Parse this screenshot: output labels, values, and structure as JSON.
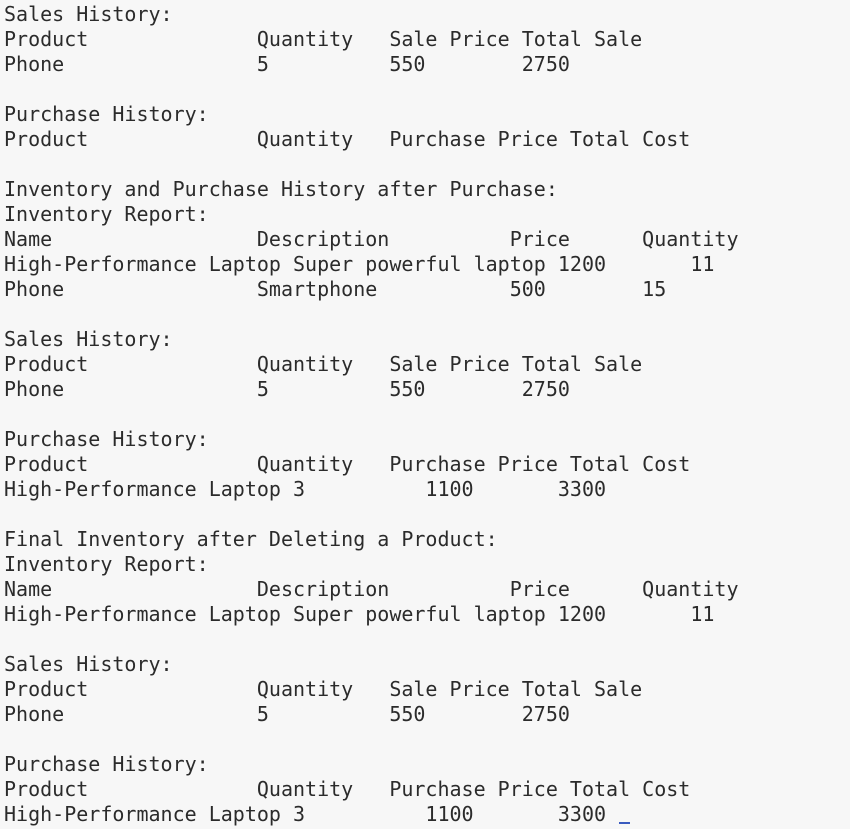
{
  "terminal": {
    "lines": [
      "Sales History:",
      "Product              Quantity   Sale Price Total Sale",
      "Phone                5          550        2750",
      "",
      "Purchase History:",
      "Product              Quantity   Purchase Price Total Cost",
      "",
      "Inventory and Purchase History after Purchase:",
      "Inventory Report:",
      "Name                 Description          Price      Quantity",
      "High-Performance Laptop Super powerful laptop 1200       11",
      "Phone                Smartphone           500        15",
      "",
      "Sales History:",
      "Product              Quantity   Sale Price Total Sale",
      "Phone                5          550        2750",
      "",
      "Purchase History:",
      "Product              Quantity   Purchase Price Total Cost",
      "High-Performance Laptop 3          1100       3300",
      "",
      "Final Inventory after Deleting a Product:",
      "Inventory Report:",
      "Name                 Description          Price      Quantity",
      "High-Performance Laptop Super powerful laptop 1200       11",
      "",
      "Sales History:",
      "Product              Quantity   Sale Price Total Sale",
      "Phone                5          550        2750",
      "",
      "Purchase History:",
      "Product              Quantity   Purchase Price Total Cost",
      "High-Performance Laptop 3          1100       3300 "
    ],
    "cursor_color": "#3a5bbf",
    "background": "#f7f7f7",
    "text_color": "#2b2b2b"
  }
}
